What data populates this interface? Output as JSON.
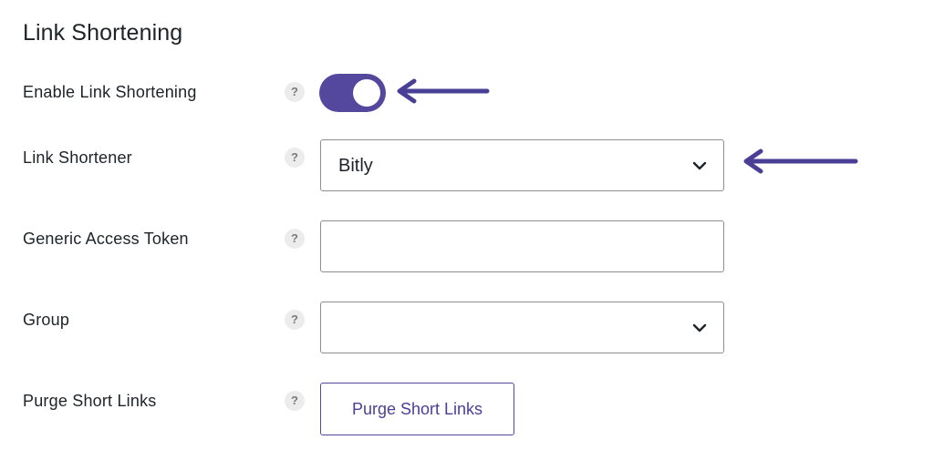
{
  "section": {
    "title": "Link Shortening"
  },
  "fields": {
    "enable": {
      "label": "Enable Link Shortening",
      "help": "?",
      "enabled": true
    },
    "shortener": {
      "label": "Link Shortener",
      "help": "?",
      "selected": "Bitly"
    },
    "token": {
      "label": "Generic Access Token",
      "help": "?",
      "value": ""
    },
    "group": {
      "label": "Group",
      "help": "?",
      "selected": ""
    },
    "purge": {
      "label": "Purge Short Links",
      "help": "?",
      "button_label": "Purge Short Links"
    }
  },
  "icons": {
    "help": "question-mark-icon",
    "select_caret": "chevron-down-icon",
    "annotation": "arrow-left-icon"
  },
  "colors": {
    "accent": "#54489e",
    "help_bg": "#ececec",
    "border": "#8c8f94"
  }
}
